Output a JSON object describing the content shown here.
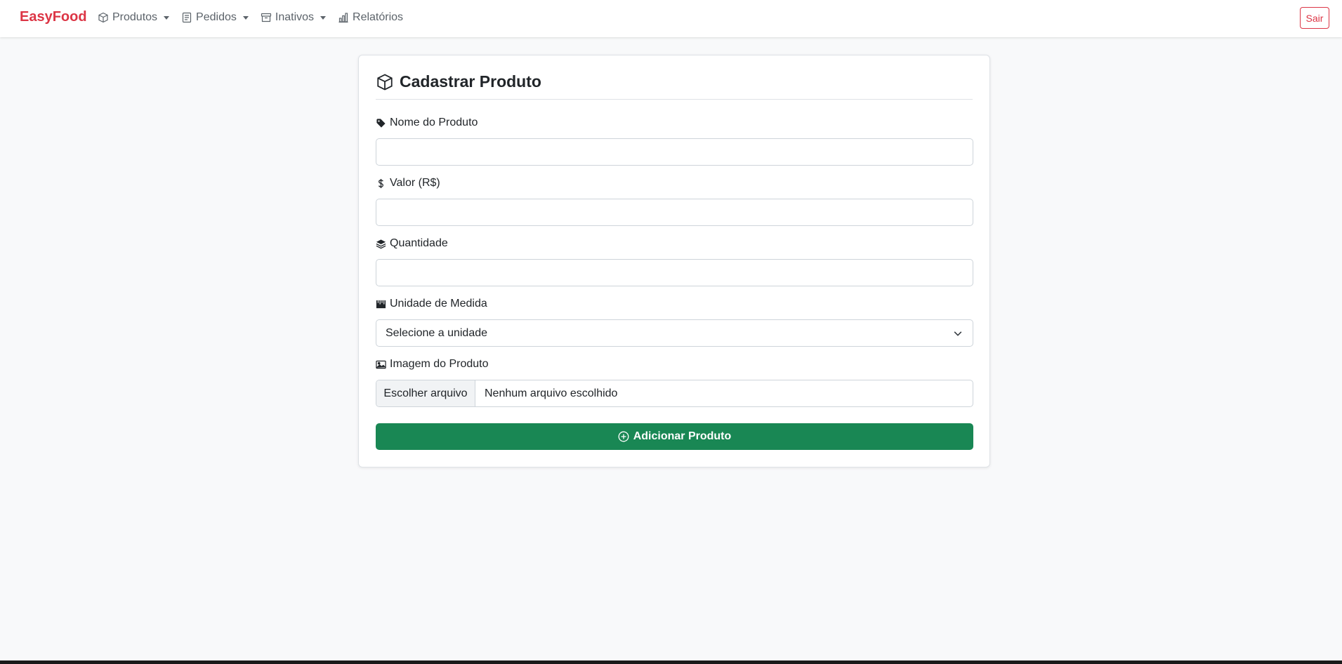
{
  "navbar": {
    "brand": "EasyFood",
    "items": [
      {
        "label": "Produtos",
        "icon": "box-icon",
        "dropdown": true
      },
      {
        "label": "Pedidos",
        "icon": "receipt-icon",
        "dropdown": true
      },
      {
        "label": "Inativos",
        "icon": "archive-icon",
        "dropdown": true
      },
      {
        "label": "Relatórios",
        "icon": "bar-chart-icon",
        "dropdown": false
      }
    ],
    "logout_label": "Sair"
  },
  "form": {
    "title": "Cadastrar Produto",
    "title_icon": "box-icon",
    "fields": {
      "name": {
        "label": "Nome do Produto",
        "icon": "tag-icon",
        "value": "",
        "placeholder": ""
      },
      "price": {
        "label": "Valor (R$)",
        "icon": "dollar-icon",
        "value": "",
        "placeholder": ""
      },
      "quantity": {
        "label": "Quantidade",
        "icon": "stack-icon",
        "value": "",
        "placeholder": ""
      },
      "unit": {
        "label": "Unidade de Medida",
        "icon": "ruler-icon",
        "selected": "Selecione a unidade"
      },
      "image": {
        "label": "Imagem do Produto",
        "icon": "image-icon",
        "button_label": "Escolher arquivo",
        "status": "Nenhum arquivo escolhido"
      }
    },
    "submit_label": "Adicionar Produto",
    "submit_icon": "plus-circle-icon"
  },
  "colors": {
    "brand": "#dc3545",
    "primary_action": "#198754",
    "danger": "#dc3545",
    "background": "#f8f9fa"
  }
}
